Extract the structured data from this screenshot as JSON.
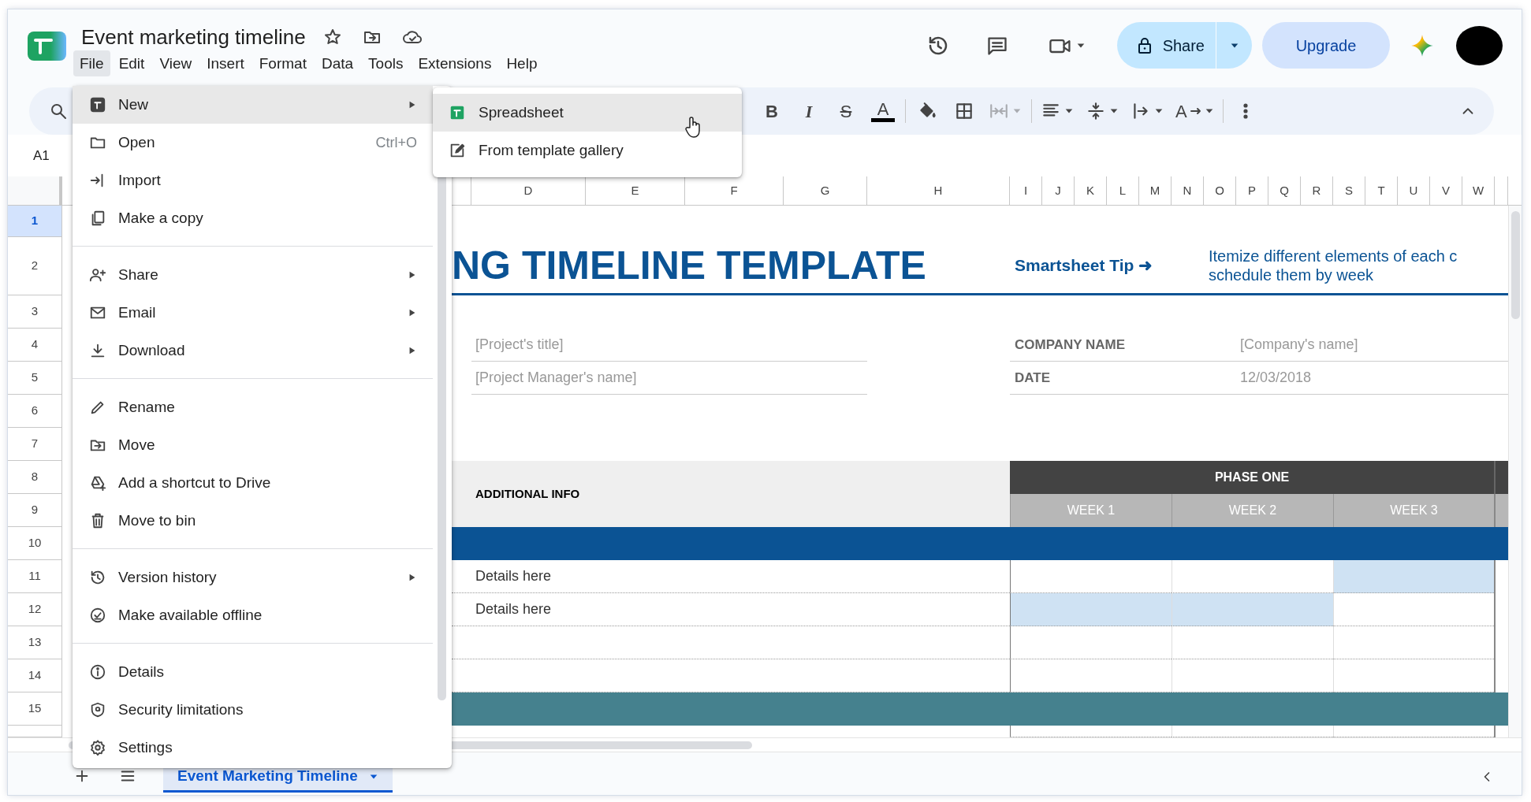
{
  "window": {
    "title": "Event marketing timeline"
  },
  "menu_bar": [
    {
      "label": "File",
      "selected": true
    },
    {
      "label": "Edit",
      "selected": false
    },
    {
      "label": "View",
      "selected": false
    },
    {
      "label": "Insert",
      "selected": false
    },
    {
      "label": "Format",
      "selected": false
    },
    {
      "label": "Data",
      "selected": false
    },
    {
      "label": "Tools",
      "selected": false
    },
    {
      "label": "Extensions",
      "selected": false
    },
    {
      "label": "Help",
      "selected": false
    }
  ],
  "header": {
    "share": "Share",
    "upgrade": "Upgrade"
  },
  "toolbar": [
    {
      "kind": "bold",
      "label": "B",
      "disabled": false,
      "dropdown": false
    },
    {
      "kind": "italic",
      "label": "I",
      "disabled": false,
      "dropdown": false
    },
    {
      "kind": "strike",
      "label": "S",
      "disabled": false,
      "dropdown": false
    },
    {
      "kind": "color",
      "label": "A",
      "disabled": false,
      "dropdown": false
    },
    {
      "kind": "divider"
    },
    {
      "kind": "fill",
      "disabled": false,
      "dropdown": false
    },
    {
      "kind": "borders",
      "disabled": false,
      "dropdown": false
    },
    {
      "kind": "merge",
      "disabled": true,
      "dropdown": true
    },
    {
      "kind": "divider"
    },
    {
      "kind": "align",
      "disabled": false,
      "dropdown": true
    },
    {
      "kind": "valign",
      "disabled": false,
      "dropdown": true
    },
    {
      "kind": "wrap",
      "disabled": false,
      "dropdown": true
    },
    {
      "kind": "rotate",
      "label": "A",
      "disabled": false,
      "dropdown": true
    },
    {
      "kind": "divider"
    },
    {
      "kind": "more",
      "disabled": false,
      "dropdown": false
    }
  ],
  "name_box": "A1",
  "columns": [
    "D",
    "E",
    "F",
    "G",
    "H",
    "I",
    "J",
    "K",
    "L",
    "M",
    "N",
    "O",
    "P",
    "Q",
    "R",
    "S",
    "T",
    "U",
    "V",
    "W"
  ],
  "rows": [
    {
      "label": "1",
      "selected": true
    },
    {
      "label": "2",
      "selected": false
    },
    {
      "label": "3",
      "selected": false
    },
    {
      "label": "4",
      "selected": false
    },
    {
      "label": "5",
      "selected": false
    },
    {
      "label": "6",
      "selected": false
    },
    {
      "label": "7",
      "selected": false
    },
    {
      "label": "8",
      "selected": false
    },
    {
      "label": "9",
      "selected": false
    },
    {
      "label": "10",
      "selected": false
    },
    {
      "label": "11",
      "selected": false
    },
    {
      "label": "12",
      "selected": false
    },
    {
      "label": "13",
      "selected": false
    },
    {
      "label": "14",
      "selected": false
    },
    {
      "label": "15",
      "selected": false
    }
  ],
  "sheet": {
    "title": "NG TIMELINE TEMPLATE",
    "tip": "Smartsheet Tip ➜",
    "tip_text": [
      "Itemize different elements of each c",
      "schedule them by week"
    ],
    "project_title": "[Project's title]",
    "project_manager": "[Project Manager's name]",
    "company_label": "COMPANY NAME",
    "company_value": "[Company's name]",
    "date_label": "DATE",
    "date_value": "12/03/2018",
    "additional_info": "ADDITIONAL INFO",
    "phase": "PHASE ONE",
    "weeks": [
      "WEEK 1",
      "WEEK 2",
      "WEEK 3"
    ],
    "task_rows": [
      {
        "details": "Details here",
        "shaded": [
          false,
          false,
          true
        ]
      },
      {
        "details": "Details here",
        "shaded": [
          true,
          true,
          false
        ]
      },
      {
        "shaded": [
          false,
          false,
          false
        ]
      },
      {
        "shaded": [
          false,
          false,
          false
        ]
      }
    ]
  },
  "file_menu": [
    {
      "kind": "item",
      "label": "New",
      "submenu": true,
      "selected": true
    },
    {
      "kind": "item",
      "label": "Open",
      "shortcut": "Ctrl+O",
      "submenu": false,
      "selected": false
    },
    {
      "kind": "item",
      "label": "Import",
      "submenu": false,
      "selected": false
    },
    {
      "kind": "item",
      "label": "Make a copy",
      "submenu": false,
      "selected": false
    },
    {
      "kind": "divider"
    },
    {
      "kind": "item",
      "label": "Share",
      "submenu": true,
      "selected": false
    },
    {
      "kind": "item",
      "label": "Email",
      "submenu": true,
      "selected": false
    },
    {
      "kind": "item",
      "label": "Download",
      "submenu": true,
      "selected": false
    },
    {
      "kind": "divider"
    },
    {
      "kind": "item",
      "label": "Rename",
      "submenu": false,
      "selected": false
    },
    {
      "kind": "item",
      "label": "Move",
      "submenu": false,
      "selected": false
    },
    {
      "kind": "item",
      "label": "Add a shortcut to Drive",
      "submenu": false,
      "selected": false
    },
    {
      "kind": "item",
      "label": "Move to bin",
      "submenu": false,
      "selected": false
    },
    {
      "kind": "divider"
    },
    {
      "kind": "item",
      "label": "Version history",
      "submenu": true,
      "selected": false
    },
    {
      "kind": "item",
      "label": "Make available offline",
      "submenu": false,
      "selected": false
    },
    {
      "kind": "divider"
    },
    {
      "kind": "item",
      "label": "Details",
      "submenu": false,
      "selected": false
    },
    {
      "kind": "item",
      "label": "Security limitations",
      "submenu": false,
      "selected": false
    },
    {
      "kind": "item",
      "label": "Settings",
      "submenu": false,
      "selected": false
    }
  ],
  "new_submenu": [
    {
      "label": "Spreadsheet",
      "selected": true
    },
    {
      "label": "From template gallery",
      "selected": false
    }
  ],
  "sheet_tabs": [
    {
      "label": "Event Marketing Timeline",
      "selected": true
    }
  ]
}
